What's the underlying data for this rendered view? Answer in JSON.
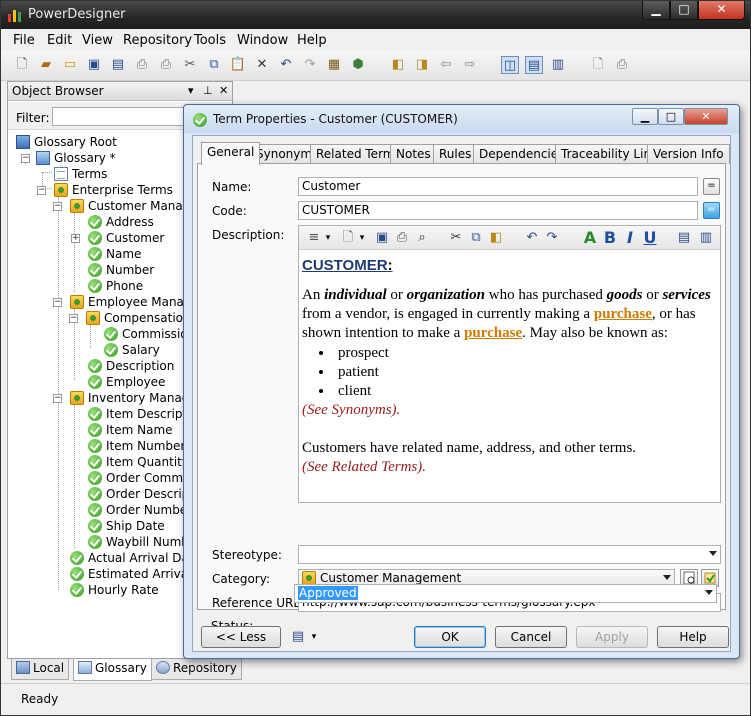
{
  "app": {
    "title": "PowerDesigner",
    "menu": [
      "File",
      "Edit",
      "View",
      "Repository",
      "Tools",
      "Window",
      "Help"
    ],
    "status": "Ready"
  },
  "object_browser": {
    "title": "Object Browser",
    "filter_label": "Filter:",
    "filter_value": "",
    "tree": [
      {
        "label": "Glossary Root",
        "icon": "glossary-root-icon"
      },
      {
        "label": "Glossary *",
        "icon": "glossary-icon"
      },
      {
        "label": "Terms",
        "icon": "terms-icon"
      },
      {
        "label": "Enterprise Terms",
        "icon": "category-icon"
      },
      {
        "label": "Customer Management",
        "icon": "category-icon"
      },
      {
        "label": "Address",
        "icon": "term-icon"
      },
      {
        "label": "Customer",
        "icon": "term-icon"
      },
      {
        "label": "Name",
        "icon": "term-icon"
      },
      {
        "label": "Number",
        "icon": "term-icon"
      },
      {
        "label": "Phone",
        "icon": "term-icon"
      },
      {
        "label": "Employee Management",
        "icon": "category-icon"
      },
      {
        "label": "Compensation",
        "icon": "category-icon"
      },
      {
        "label": "Commission",
        "icon": "term-icon"
      },
      {
        "label": "Salary",
        "icon": "term-icon"
      },
      {
        "label": "Description",
        "icon": "term-icon"
      },
      {
        "label": "Employee",
        "icon": "term-icon"
      },
      {
        "label": "Inventory Management",
        "icon": "category-icon"
      },
      {
        "label": "Item Description",
        "icon": "term-icon"
      },
      {
        "label": "Item Name",
        "icon": "term-icon"
      },
      {
        "label": "Item Number",
        "icon": "term-icon"
      },
      {
        "label": "Item Quantity",
        "icon": "term-icon"
      },
      {
        "label": "Order Comments",
        "icon": "term-icon"
      },
      {
        "label": "Order Description",
        "icon": "term-icon"
      },
      {
        "label": "Order Number",
        "icon": "term-icon"
      },
      {
        "label": "Ship Date",
        "icon": "term-icon"
      },
      {
        "label": "Waybill Number",
        "icon": "term-icon"
      },
      {
        "label": "Actual Arrival Date",
        "icon": "term-icon"
      },
      {
        "label": "Estimated Arrival date",
        "icon": "term-icon"
      },
      {
        "label": "Hourly Rate",
        "icon": "term-icon"
      }
    ],
    "tabs": [
      "Local",
      "Glossary",
      "Repository"
    ]
  },
  "dialog": {
    "title": "Term Properties - Customer (CUSTOMER)",
    "tabs": [
      "General",
      "Synonyms",
      "Related Terms",
      "Notes",
      "Rules",
      "Dependencies",
      "Traceability Links",
      "Version Info"
    ],
    "fields": {
      "name_label": "Name:",
      "name_value": "Customer",
      "code_label": "Code:",
      "code_value": "CUSTOMER",
      "description_label": "Description:",
      "stereotype_label": "Stereotype:",
      "stereotype_value": "",
      "category_label": "Category:",
      "category_value": "Customer Management",
      "reference_url_label": "Reference URL:",
      "reference_url_value": "http://www.sap.com/business-terms/glossary.epx",
      "status_label": "Status:",
      "status_value": "Approved"
    },
    "description": {
      "heading": "CUSTOMER",
      "heading_colon": ":",
      "p1_a": "An ",
      "p1_b": "individual",
      "p1_c": " or ",
      "p1_d": "organization",
      "p1_e": " who has purchased ",
      "p1_f": "goods",
      "p1_g": " or ",
      "p1_h": "services",
      "p1_i": " from a vendor, is engaged in currently making a ",
      "p1_link1": "purchase",
      "p1_j": ", or has shown intention to make a ",
      "p1_link2": "purchase",
      "p1_k": ".  May also be known as:",
      "bullets": [
        "prospect",
        "patient",
        "client"
      ],
      "see_synonyms": "(See Synonyms).",
      "p2": "Customers have related name, address, and other terms.",
      "see_related": "(See Related Terms)."
    },
    "buttons": {
      "less": "<< Less",
      "ok": "OK",
      "cancel": "Cancel",
      "apply": "Apply",
      "help": "Help"
    }
  }
}
